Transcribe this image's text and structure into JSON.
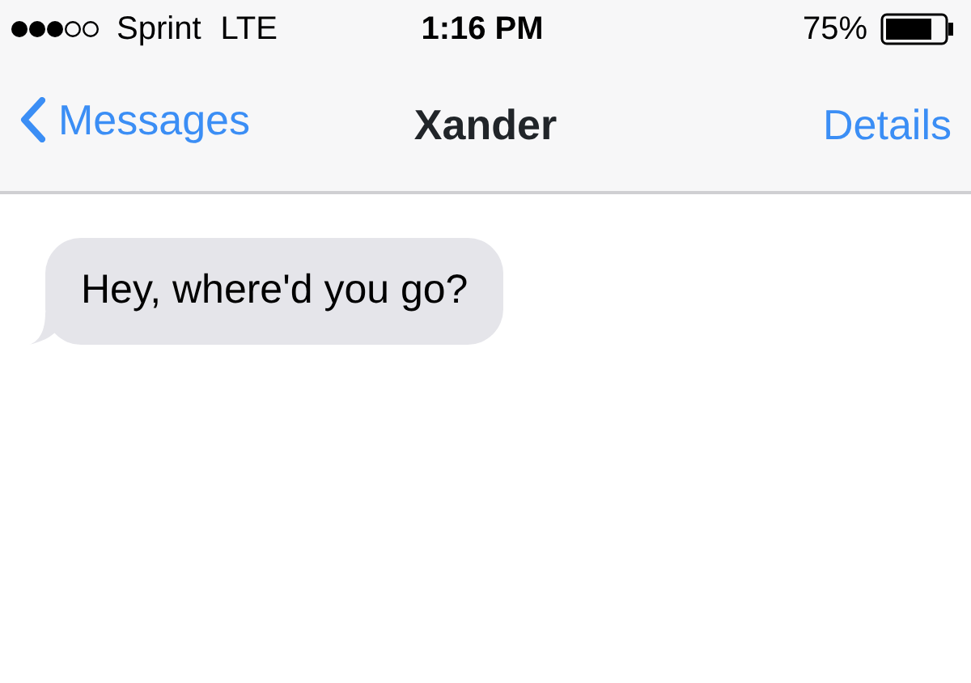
{
  "status_bar": {
    "carrier": "Sprint",
    "network": "LTE",
    "time": "1:16 PM",
    "battery": "75%"
  },
  "nav_bar": {
    "back": "Messages",
    "title": "Xander",
    "action": "Details"
  },
  "messages": [
    {
      "kind": "incoming",
      "text": "Hey, where'd you go?"
    }
  ]
}
